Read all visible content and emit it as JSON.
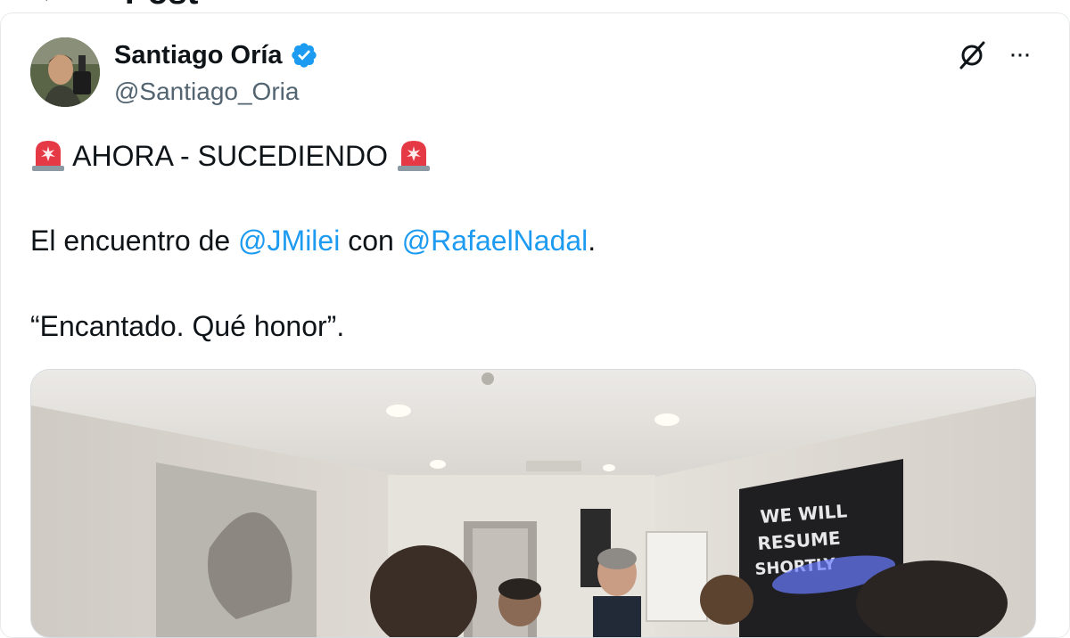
{
  "header": {
    "title": "Post",
    "back_icon": "arrow-left-icon"
  },
  "post": {
    "author_name": "Santiago Oría",
    "author_handle": "@Santiago_Oria",
    "verified": true,
    "verified_color": "#1d9bf0",
    "icons": {
      "grok": "grok-icon",
      "more": "more-icon"
    },
    "more_glyph": "···",
    "line1": {
      "emoji": "siren-icon",
      "text": "AHORA - SUCEDIENDO"
    },
    "line2": {
      "before": "El encuentro de ",
      "mention1": "@JMilei",
      "between": " con ",
      "mention2": "@RafaelNadal",
      "after": "."
    },
    "line3": "“Encantado. Qué honor”.",
    "media": {
      "poster_lines": [
        "WE WILL",
        "RESUME",
        "SHORTLY"
      ]
    }
  },
  "colors": {
    "mention": "#1d9bf0",
    "text": "#0f1419",
    "secondary": "#536471"
  }
}
